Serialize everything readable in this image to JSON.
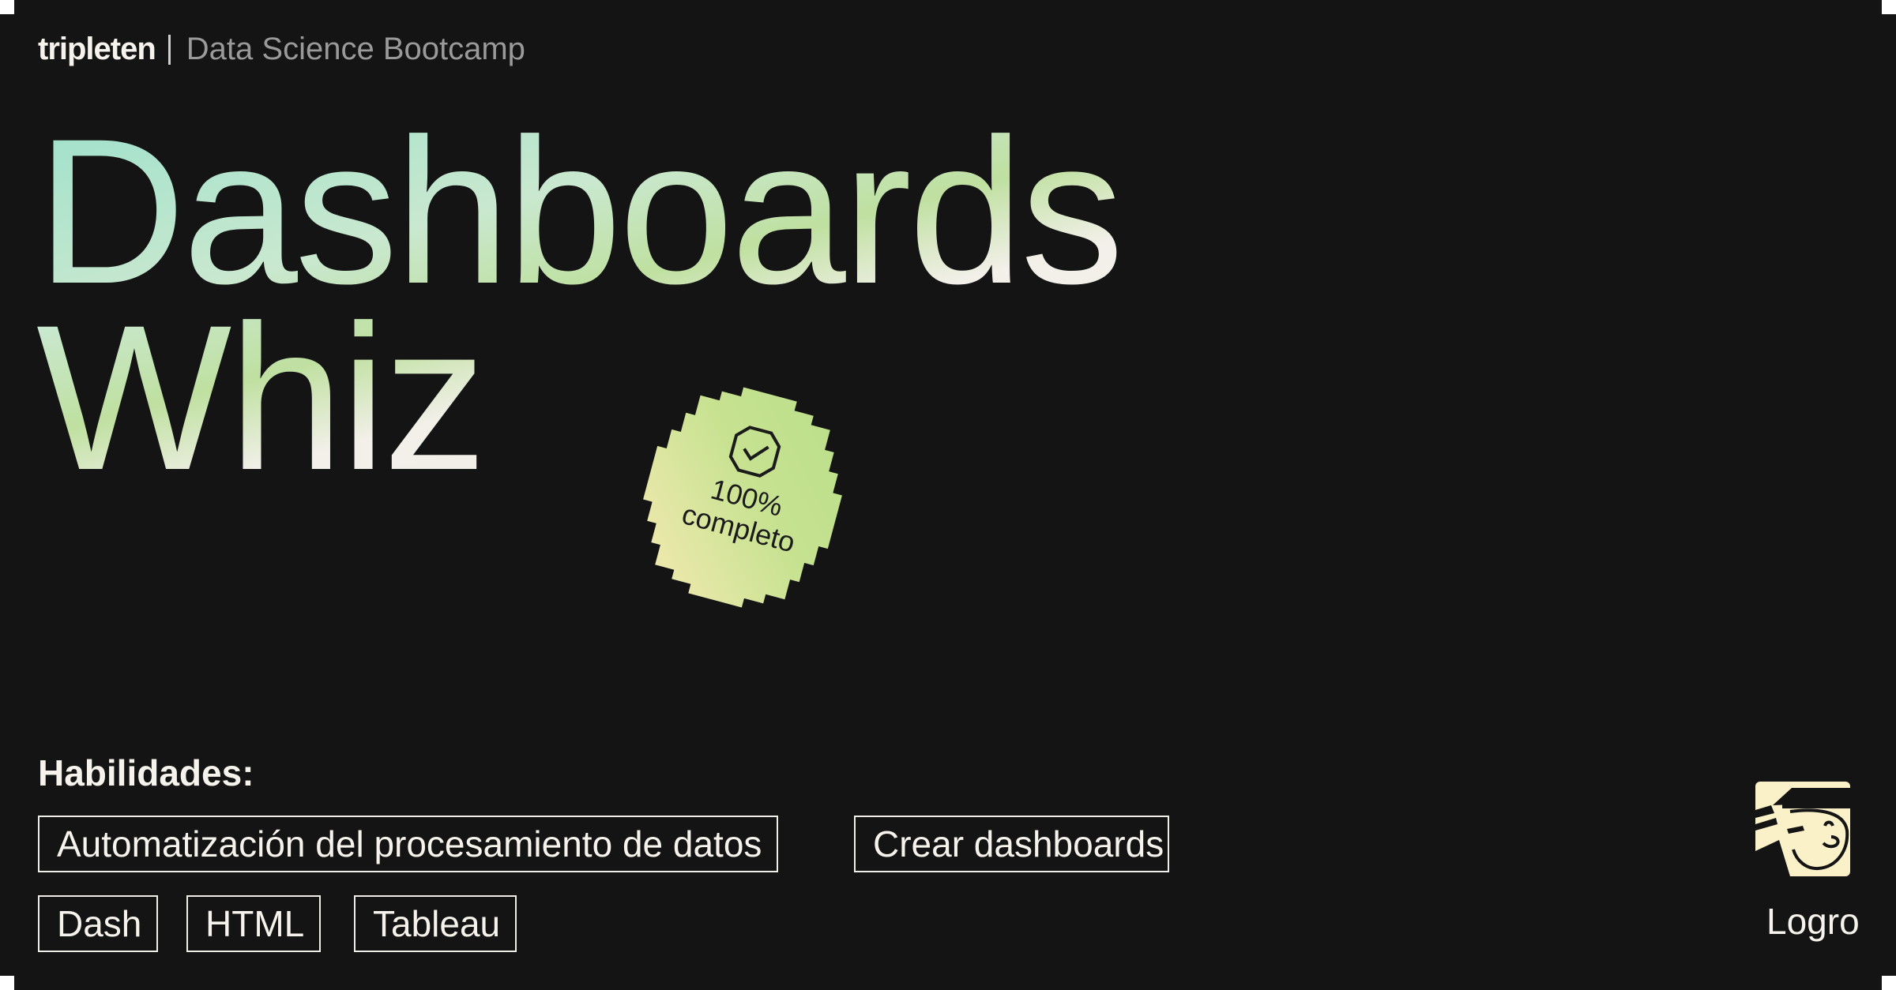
{
  "brand": {
    "logo": "tripleten",
    "program": "Data Science Bootcamp"
  },
  "title": {
    "line1": "Dashboards",
    "line2": "Whiz"
  },
  "badge": {
    "percent": "100%",
    "status": "completo",
    "icon": "check-circle-icon"
  },
  "skills": {
    "label": "Habilidades:",
    "items": [
      "Automatización del procesamiento de datos",
      "Crear dashboards",
      "Dash",
      "HTML",
      "Tableau"
    ]
  },
  "achievement": {
    "label": "Logro",
    "icon": "detective-character-icon"
  },
  "colors": {
    "background": "#141414",
    "text": "#f3f1ea",
    "muted_text": "#9a9a9a",
    "title_gradient": [
      "#9fe1cc",
      "#c9e8cf",
      "#bfe0a0",
      "#f3f0ea",
      "#dfeccf"
    ],
    "badge_gradient": [
      "#b9de8a",
      "#f5e9b0"
    ],
    "icon_background": "#fbf1c8"
  }
}
